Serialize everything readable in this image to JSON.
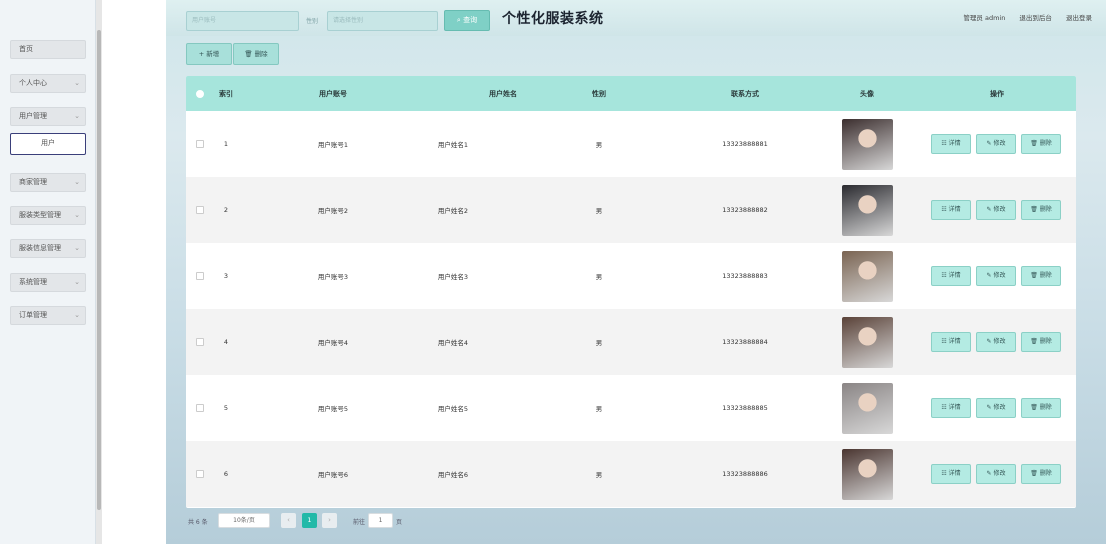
{
  "app": {
    "title": "个性化服装系统"
  },
  "search": {
    "field1_placeholder": "用户账号",
    "field2_label": "性别",
    "field2_placeholder": "请选择性别",
    "button_label": "⌕ 查询"
  },
  "header_links": {
    "admin": "管理员 admin",
    "backend": "退出到后台",
    "logout": "退出登录"
  },
  "sidebar": {
    "items": [
      {
        "label": "首页",
        "chevron": ""
      },
      {
        "label": "个人中心",
        "chevron": "⌄"
      },
      {
        "label": "用户管理",
        "chevron": "⌄"
      },
      {
        "label": "用户",
        "chevron": ""
      },
      {
        "label": "商家管理",
        "chevron": "⌄"
      },
      {
        "label": "服装类型管理",
        "chevron": "⌄"
      },
      {
        "label": "服装信息管理",
        "chevron": "⌄"
      },
      {
        "label": "系统管理",
        "chevron": "⌄"
      },
      {
        "label": "订单管理",
        "chevron": "⌄"
      }
    ]
  },
  "toolbar": {
    "add_label": "+ 新增",
    "delete_label": "🗑 删除"
  },
  "table": {
    "headers": {
      "index": "索引",
      "account": "用户账号",
      "name": "用户姓名",
      "gender": "性别",
      "phone": "联系方式",
      "avatar": "头像",
      "actions": "操作"
    },
    "rows": [
      {
        "index": "1",
        "account": "用户账号1",
        "name": "用户姓名1",
        "gender": "男",
        "phone": "13323888881",
        "avatar_color": "#3b2e2e"
      },
      {
        "index": "2",
        "account": "用户账号2",
        "name": "用户姓名2",
        "gender": "男",
        "phone": "13323888882",
        "avatar_color": "#2a2a2f"
      },
      {
        "index": "3",
        "account": "用户账号3",
        "name": "用户姓名3",
        "gender": "男",
        "phone": "13323888883",
        "avatar_color": "#7a6452"
      },
      {
        "index": "4",
        "account": "用户账号4",
        "name": "用户姓名4",
        "gender": "男",
        "phone": "13323888884",
        "avatar_color": "#5a4238"
      },
      {
        "index": "5",
        "account": "用户账号5",
        "name": "用户姓名5",
        "gender": "男",
        "phone": "13323888885",
        "avatar_color": "#8a8585"
      },
      {
        "index": "6",
        "account": "用户账号6",
        "name": "用户姓名6",
        "gender": "男",
        "phone": "13323888886",
        "avatar_color": "#4a3530"
      }
    ],
    "row_actions": {
      "detail": "☷ 详情",
      "edit": "✎ 修改",
      "delete": "🗑 删除"
    }
  },
  "pagination": {
    "total_label": "共 6 条",
    "page_size": "10条/页",
    "prev": "‹",
    "current_page": "1",
    "next": "›",
    "goto_label": "前往",
    "goto_value": "1",
    "goto_suffix": "页"
  }
}
